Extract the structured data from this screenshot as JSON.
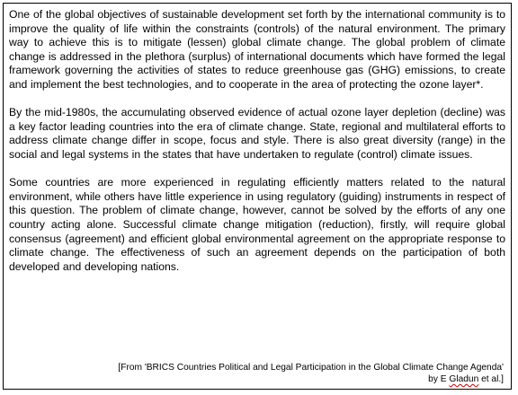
{
  "document": {
    "paragraphs": [
      "One of the global objectives of sustainable development set forth by the international community is to improve the quality of life within the constraints (controls) of the natural environment. The primary way to achieve this is to mitigate (lessen) global climate change. The global problem of climate change is addressed in the plethora (surplus) of international documents which have formed the legal framework governing the activities of states to reduce greenhouse gas (GHG) emissions, to create and implement the best technologies, and to cooperate in the area of protecting the ozone layer*.",
      "By the mid-1980s, the accumulating observed evidence of actual ozone layer depletion (decline) was a key factor leading countries into the era of climate change. State, regional and multilateral efforts to address climate change differ in scope, focus and style. There is also great diversity (range) in the social and legal systems in the states that have undertaken to regulate (control) climate issues.",
      "Some countries are more experienced in regulating efficiently matters related to the natural environment, while others have little experience in using regulatory (guiding) instruments in respect of this question. The problem of climate change, however, cannot be solved by the efforts of any one country acting alone. Successful climate change mitigation (reduction), firstly, will require global consensus (agreement) and efficient global environmental agreement on the appropriate response to climate change. The effectiveness of such an agreement depends on the participation of both developed and developing nations."
    ],
    "source": {
      "line1": "[From 'BRICS Countries Political and Legal Participation in the Global Climate Change Agenda'",
      "line2_prefix": "by E ",
      "line2_author": "Gladun",
      "line2_suffix": " et al.]"
    }
  }
}
